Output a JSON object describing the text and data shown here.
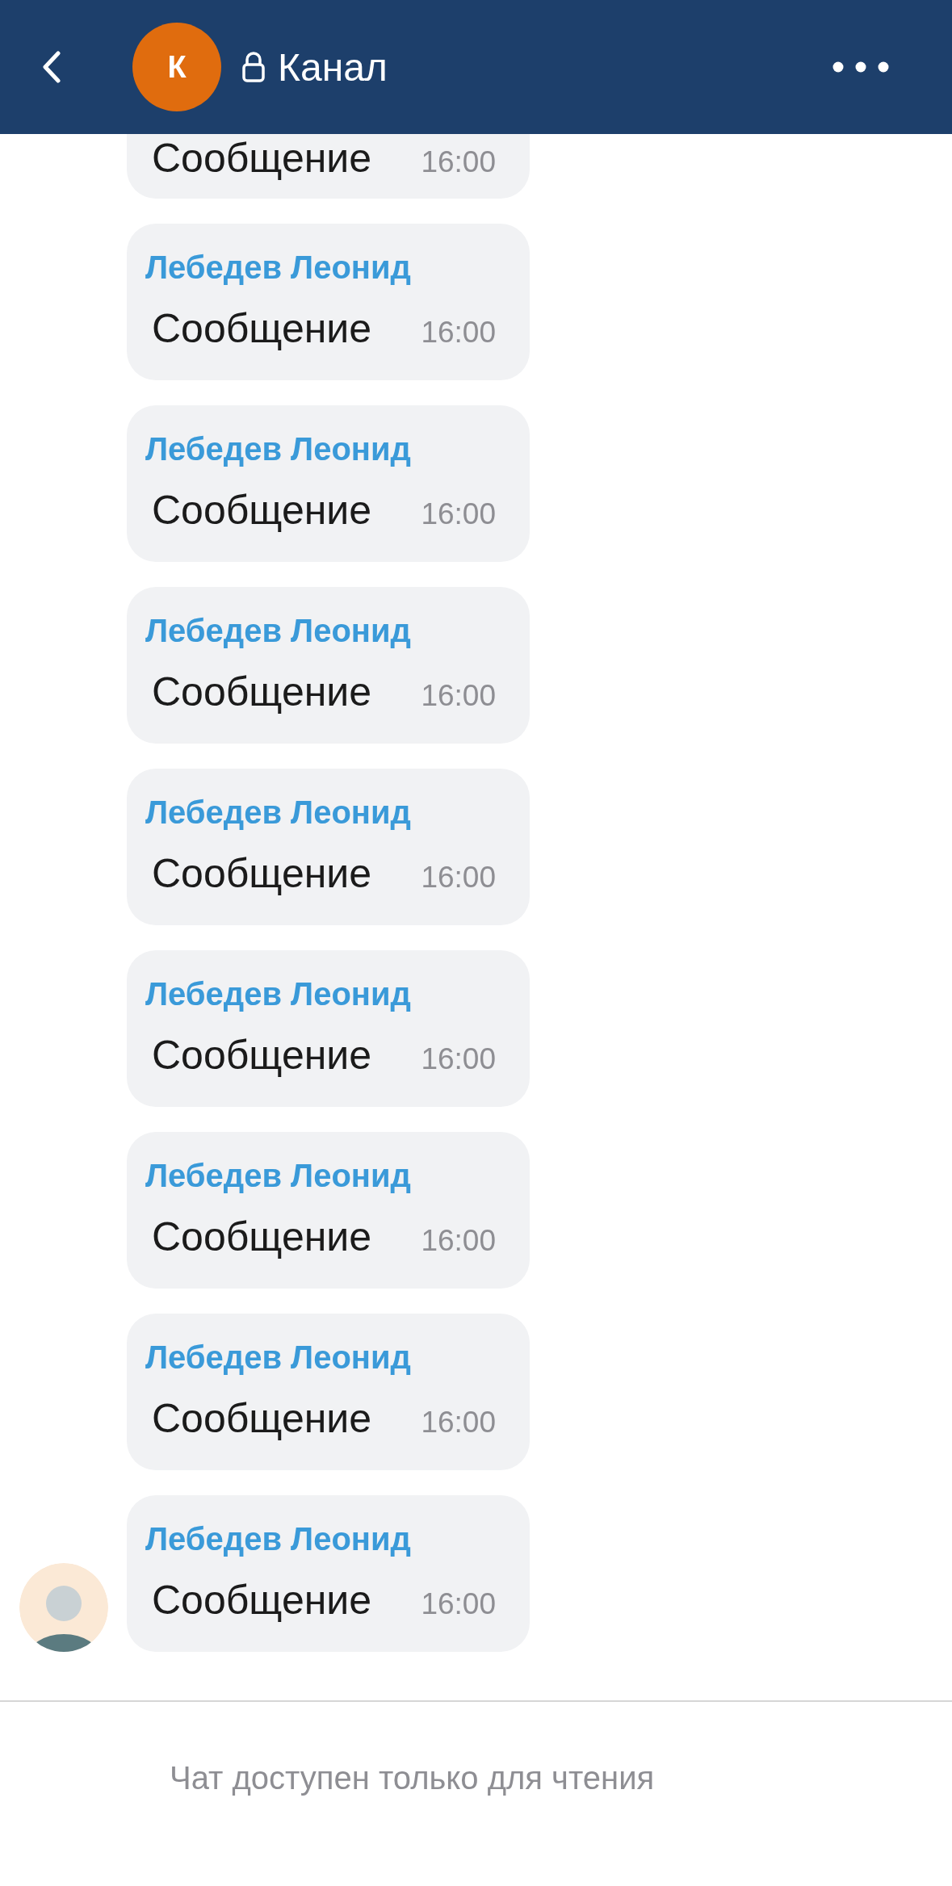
{
  "header": {
    "avatar_letter": "К",
    "title": "Канал"
  },
  "messages": [
    {
      "text": "Сообщение",
      "time": "16:00"
    },
    {
      "sender": "Лебедев Леонид",
      "text": "Сообщение",
      "time": "16:00"
    },
    {
      "sender": "Лебедев Леонид",
      "text": "Сообщение",
      "time": "16:00"
    },
    {
      "sender": "Лебедев Леонид",
      "text": "Сообщение",
      "time": "16:00"
    },
    {
      "sender": "Лебедев Леонид",
      "text": "Сообщение",
      "time": "16:00"
    },
    {
      "sender": "Лебедев Леонид",
      "text": "Сообщение",
      "time": "16:00"
    },
    {
      "sender": "Лебедев Леонид",
      "text": "Сообщение",
      "time": "16:00"
    },
    {
      "sender": "Лебедев Леонид",
      "text": "Сообщение",
      "time": "16:00"
    },
    {
      "sender": "Лебедев Леонид",
      "text": "Сообщение",
      "time": "16:00"
    }
  ],
  "footer": {
    "notice": "Чат доступен только для чтения"
  }
}
